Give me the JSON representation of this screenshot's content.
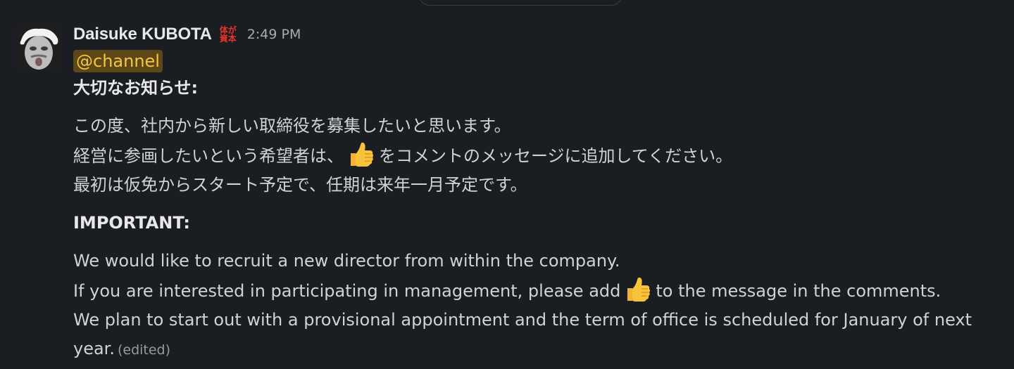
{
  "message": {
    "author": "Daisuke KUBOTA",
    "status_emoji": {
      "icon": "status-emoji-icon",
      "text_line1": "体が",
      "text_line2": "資本",
      "color": "#e8332c"
    },
    "timestamp": "2:49 PM",
    "mention": "@channel",
    "jp_title": "大切なお知らせ:",
    "jp_lines": {
      "line1": "この度、社内から新しい取締役を募集したいと思います。",
      "line2_before": "経営に参画したいという希望者は、",
      "line2_after": "をコメントのメッセージに追加してください。",
      "line3": "最初は仮免からスタート予定で、任期は来年一月予定です。"
    },
    "en_title": "IMPORTANT:",
    "en_lines": {
      "line1": "We would like to recruit a new director from within the company.",
      "line2_before": "If you are interested in participating in management, please add",
      "line2_after": "to the message in the comments.",
      "line3": "We plan to start out with a provisional appointment and the term of office is scheduled for January of next year."
    },
    "edited_label": "(edited)"
  },
  "colors": {
    "background": "#1a1d21",
    "text": "#d1d2d3",
    "mention_bg": "#5d4617",
    "mention_text": "#f2c744"
  }
}
